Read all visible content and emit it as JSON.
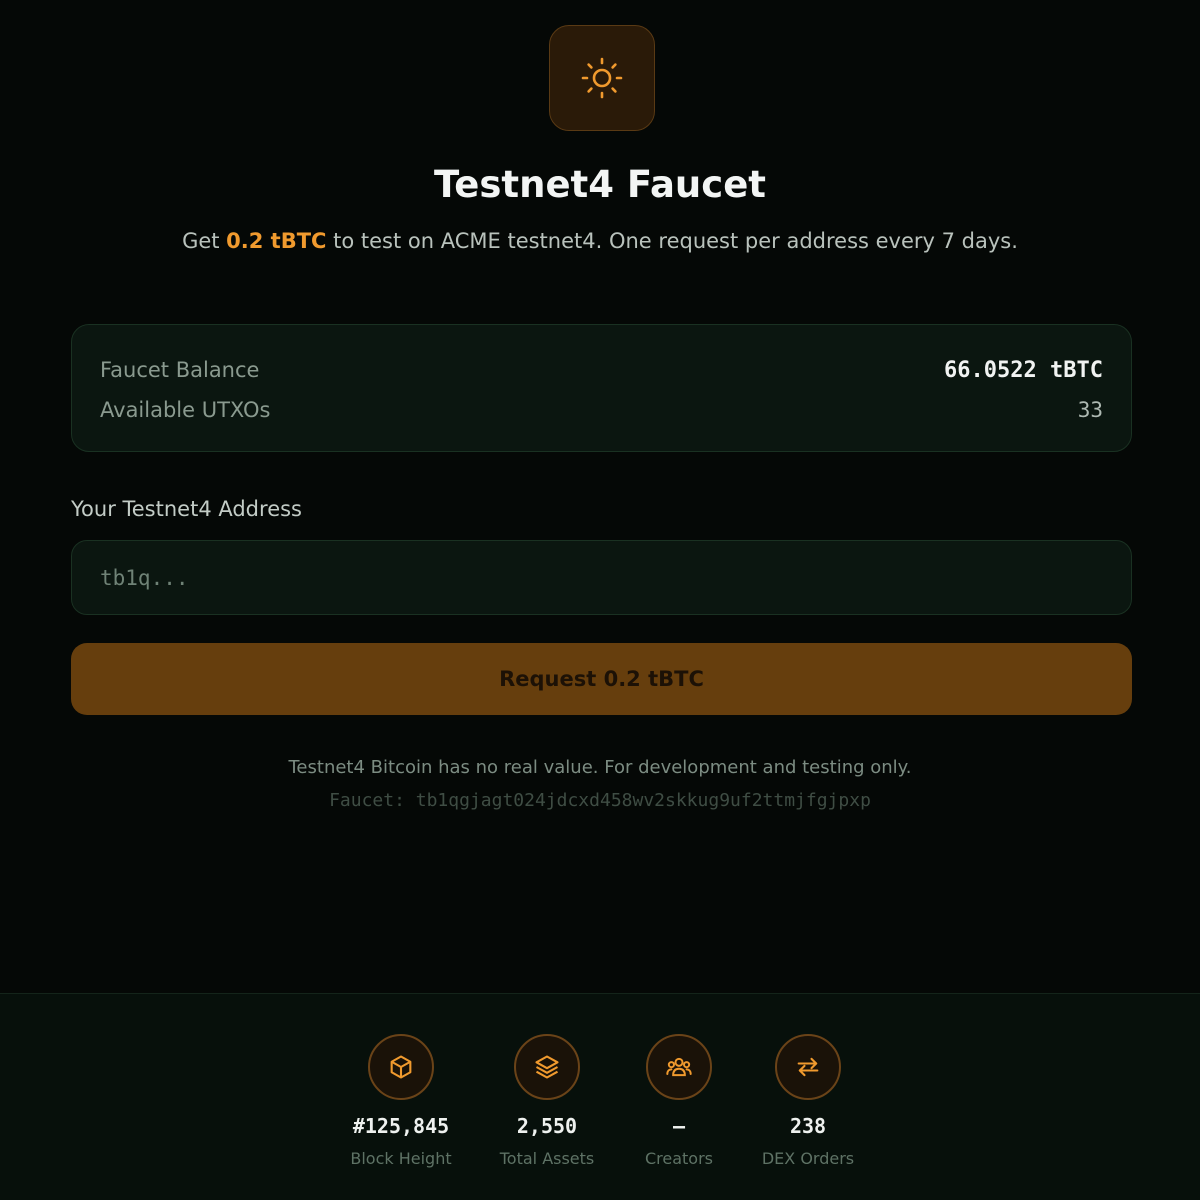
{
  "header": {
    "title": "Testnet4 Faucet",
    "subtitle_prefix": "Get ",
    "subtitle_amount": "0.2 tBTC",
    "subtitle_suffix": " to test on ACME testnet4. One request per address every 7 days.",
    "logo_icon": "sun-icon"
  },
  "stats": {
    "balance_label": "Faucet Balance",
    "balance_value": "66.0522 tBTC",
    "utxo_label": "Available UTXOs",
    "utxo_value": "33"
  },
  "form": {
    "address_label": "Your Testnet4 Address",
    "address_value": "",
    "address_placeholder": "tb1q...",
    "submit_label": "Request 0.2 tBTC"
  },
  "notes": {
    "disclaimer": "Testnet4 Bitcoin has no real value. For development and testing only.",
    "faucet_address": "Faucet: tb1qgjagt024jdcxd458wv2skkug9uf2ttmjfgjpxp"
  },
  "footer": {
    "stats": [
      {
        "icon": "cube-icon",
        "value": "#125,845",
        "label": "Block Height"
      },
      {
        "icon": "layers-icon",
        "value": "2,550",
        "label": "Total Assets"
      },
      {
        "icon": "users-icon",
        "value": "—",
        "label": "Creators"
      },
      {
        "icon": "swap-icon",
        "value": "238",
        "label": "DEX Orders"
      }
    ]
  },
  "colors": {
    "background": "#050806",
    "accent": "#f09a2e",
    "card": "#0b1610",
    "button": "#663e0d"
  }
}
